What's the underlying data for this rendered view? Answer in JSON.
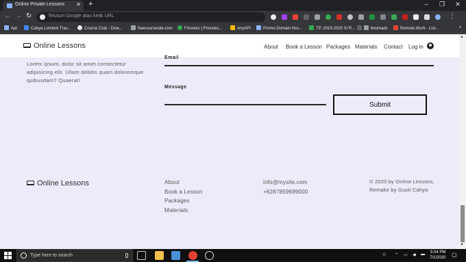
{
  "browser": {
    "tab_title": "Online Private Lessons",
    "tab_close": "✕",
    "new_tab": "+",
    "window_controls": [
      "–",
      "❐",
      "✕"
    ],
    "nav_icons": [
      "arrow-left-icon",
      "arrow-right-icon",
      "reload-icon"
    ],
    "omnibox_placeholder": "Telusuri Google atau ketik URL",
    "bookmarks": [
      "Apl",
      "Cahya Lombok Trav...",
      "Course Club - Dow...",
      "freecoursesite.com",
      "Fmovies | Fmovies...",
      "AnyAPI",
      "Promo Domain Hos...",
      "TP. 2019-2020 XI R...",
      "",
      "6nomads",
      "Remote.Work - List..."
    ],
    "bookmark_more": "»"
  },
  "site": {
    "brand": "Online Lessons",
    "nav": [
      "About",
      "Book a Lesson",
      "Packages",
      "Materials",
      "Contact",
      "Log in"
    ],
    "about_text": "Lorem ipsum, dolor sit amet consectetur adipisicing elit. Ullam debitis quam doloremque quibusdam? Quaerat!",
    "form": {
      "email_label": "Email",
      "message_label": "Message",
      "submit_label": "Submit"
    },
    "footer": {
      "brand": "Online Lessons",
      "links": [
        "About",
        "Book a Lesson",
        "Packages",
        "Materials"
      ],
      "email": "info@mysite.com",
      "phone": "+6287859689000",
      "copyright": "© 2020 by Online Lessons.",
      "credit": "Remake by Gusti Cahya"
    }
  },
  "taskbar": {
    "search_placeholder": "Type here to search",
    "time": "5:04 PM",
    "date": "7/1/2020"
  },
  "colors": {
    "page_background": "#ebebf9",
    "nav_background": "#ffffff",
    "chrome_dark": "#202124",
    "chrome_toolbar": "#35363a"
  }
}
